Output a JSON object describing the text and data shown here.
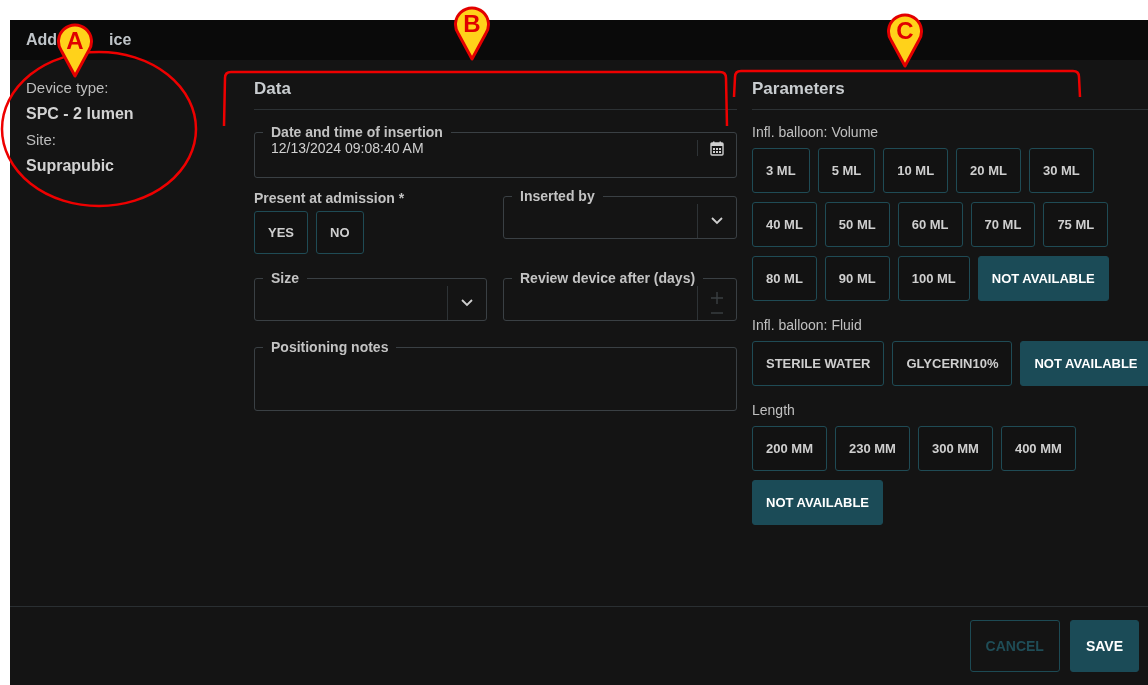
{
  "window": {
    "title_fragments": [
      "Add",
      "ice"
    ]
  },
  "device_info": [
    {
      "kind": "label",
      "text": "Device type:"
    },
    {
      "kind": "value",
      "text": "SPC - 2 lumen"
    },
    {
      "kind": "label",
      "text": "Site:"
    },
    {
      "kind": "value",
      "text": "Suprapubic"
    }
  ],
  "data": {
    "heading": "Data",
    "date_time": {
      "label": "Date and time of insertion",
      "value": "12/13/2024 09:08:40 AM"
    },
    "present_at_admission": {
      "label": "Present at admission *",
      "options": [
        {
          "label": "YES",
          "selected": false
        },
        {
          "label": "NO",
          "selected": false
        }
      ]
    },
    "inserted_by": {
      "label": "Inserted by"
    },
    "size": {
      "label": "Size"
    },
    "review_after": {
      "label": "Review device after (days)"
    },
    "positioning_notes": {
      "label": "Positioning notes"
    }
  },
  "parameters": {
    "heading": "Parameters",
    "groups": [
      {
        "label": "Infl. balloon: Volume",
        "options": [
          {
            "label": "3 ML",
            "selected": false
          },
          {
            "label": "5 ML",
            "selected": false
          },
          {
            "label": "10 ML",
            "selected": false
          },
          {
            "label": "20 ML",
            "selected": false
          },
          {
            "label": "30 ML",
            "selected": false
          },
          {
            "label": "40 ML",
            "selected": false
          },
          {
            "label": "50 ML",
            "selected": false
          },
          {
            "label": "60 ML",
            "selected": false
          },
          {
            "label": "70 ML",
            "selected": false
          },
          {
            "label": "75 ML",
            "selected": false
          },
          {
            "label": "80 ML",
            "selected": false
          },
          {
            "label": "90 ML",
            "selected": false
          },
          {
            "label": "100 ML",
            "selected": false
          },
          {
            "label": "NOT AVAILABLE",
            "selected": true
          }
        ]
      },
      {
        "label": "Infl. balloon: Fluid",
        "options": [
          {
            "label": "STERILE WATER",
            "selected": false
          },
          {
            "label": "GLYCERIN10%",
            "selected": false
          },
          {
            "label": "NOT AVAILABLE",
            "selected": true
          }
        ]
      },
      {
        "label": "Length",
        "options": [
          {
            "label": "200 MM",
            "selected": false
          },
          {
            "label": "230 MM",
            "selected": false
          },
          {
            "label": "300 MM",
            "selected": false
          },
          {
            "label": "400 MM",
            "selected": false
          },
          {
            "label": "NOT AVAILABLE",
            "selected": true
          }
        ]
      }
    ]
  },
  "footer": {
    "buttons": [
      {
        "label": "CANCEL",
        "kind": "secondary",
        "disabled": true
      },
      {
        "label": "SAVE",
        "kind": "primary",
        "disabled": false
      }
    ]
  },
  "annotations": [
    {
      "letter": "A"
    },
    {
      "letter": "B"
    },
    {
      "letter": "C"
    }
  ]
}
